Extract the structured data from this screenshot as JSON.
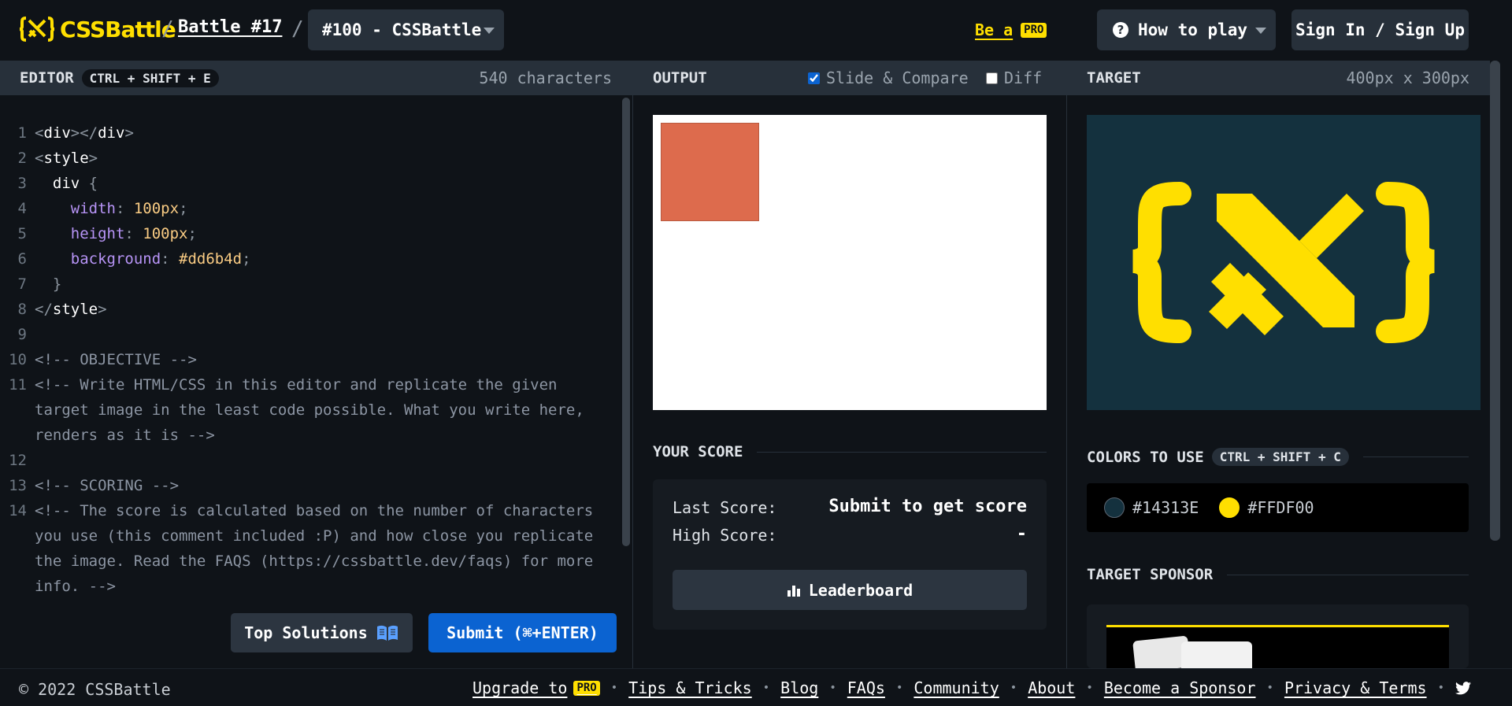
{
  "header": {
    "logo_text": "CSSBattle",
    "battle_link": "Battle #17",
    "separator": "/",
    "battle_select": "#100 - CSSBattle",
    "be_a": "Be a",
    "pro_badge": "PRO",
    "how_to_play": "How to play",
    "sign_in": "Sign In / Sign Up"
  },
  "editor": {
    "title": "EDITOR",
    "shortcut": "CTRL + SHIFT + E",
    "char_count": "540 characters",
    "line_numbers": [
      "1",
      "2",
      "3",
      "4",
      "5",
      "6",
      "7",
      "8",
      "9",
      "10",
      "11",
      "12",
      "13",
      "14"
    ],
    "top_solutions": "Top Solutions",
    "submit": "Submit (⌘+ENTER)",
    "code": {
      "l1_tag": "div",
      "l2_tag": "style",
      "l3_sel": "div",
      "l4_prop": "width",
      "l4_val": "100px",
      "l5_prop": "height",
      "l5_val": "100px",
      "l6_prop": "background",
      "l6_val": "#dd6b4d",
      "l8_tag": "style",
      "l10": "<!-- OBJECTIVE -->",
      "l11": "<!-- Write HTML/CSS in this editor and replicate the given target image in the least code possible. What you write here, renders as it is -->",
      "l13": "<!-- SCORING -->",
      "l14": "<!-- The score is calculated based on the number of characters you use (this comment included :P) and how close you replicate the image. Read the FAQS (https://cssbattle.dev/faqs) for more info. -->"
    }
  },
  "output": {
    "title": "OUTPUT",
    "slide_compare": "Slide & Compare",
    "slide_compare_checked": true,
    "diff": "Diff",
    "diff_checked": false,
    "square_color": "#dd6b4d"
  },
  "score": {
    "title": "YOUR SCORE",
    "last_label": "Last Score:",
    "last_value": "Submit to get score",
    "high_label": "High Score:",
    "high_value": "-",
    "leaderboard": "Leaderboard"
  },
  "target": {
    "title": "TARGET",
    "size": "400px x 300px",
    "bg_color": "#14313E",
    "fg_color": "#FFDF00",
    "colors_title": "COLORS TO USE",
    "colors_shortcut": "CTRL + SHIFT + C",
    "colors": [
      {
        "hex": "#14313E"
      },
      {
        "hex": "#FFDF00"
      }
    ],
    "sponsor_title": "TARGET SPONSOR"
  },
  "footer": {
    "copyright": "© 2022 CSSBattle",
    "upgrade": "Upgrade to",
    "pro_badge": "PRO",
    "links": [
      "Tips & Tricks",
      "Blog",
      "FAQs",
      "Community",
      "About",
      "Become a Sponsor",
      "Privacy & Terms"
    ],
    "bullet": "•"
  }
}
